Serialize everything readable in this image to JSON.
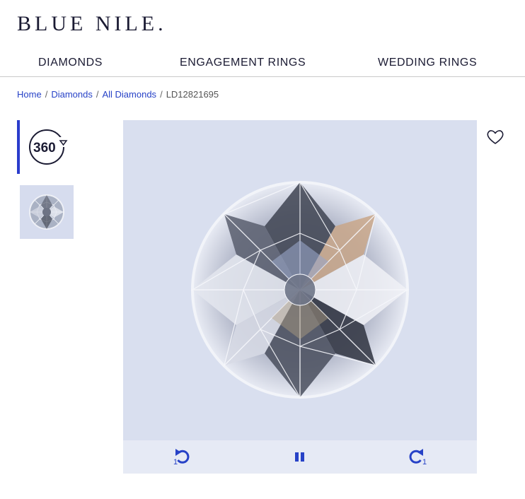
{
  "brand": {
    "logo_text": "BLUE NILE."
  },
  "nav": [
    {
      "label": "DIAMONDS"
    },
    {
      "label": "ENGAGEMENT RINGS"
    },
    {
      "label": "WEDDING RINGS"
    }
  ],
  "breadcrumb": {
    "items": [
      {
        "label": "Home"
      },
      {
        "label": "Diamonds"
      },
      {
        "label": "All Diamonds"
      }
    ],
    "separator": "/",
    "current": "LD12821695"
  },
  "gallery": {
    "thumb_360_label": "360",
    "selected_thumb": "360",
    "controls": {
      "rewind_icon": "rotate-left-icon",
      "rewind_step": "1",
      "play_state_icon": "pause-icon",
      "forward_icon": "rotate-right-icon",
      "forward_step": "1"
    }
  },
  "wishlist": {
    "icon": "heart-icon"
  },
  "colors": {
    "accent": "#2742c7",
    "brand": "#1b1b33",
    "viewer_bg": "#d9dfef"
  }
}
